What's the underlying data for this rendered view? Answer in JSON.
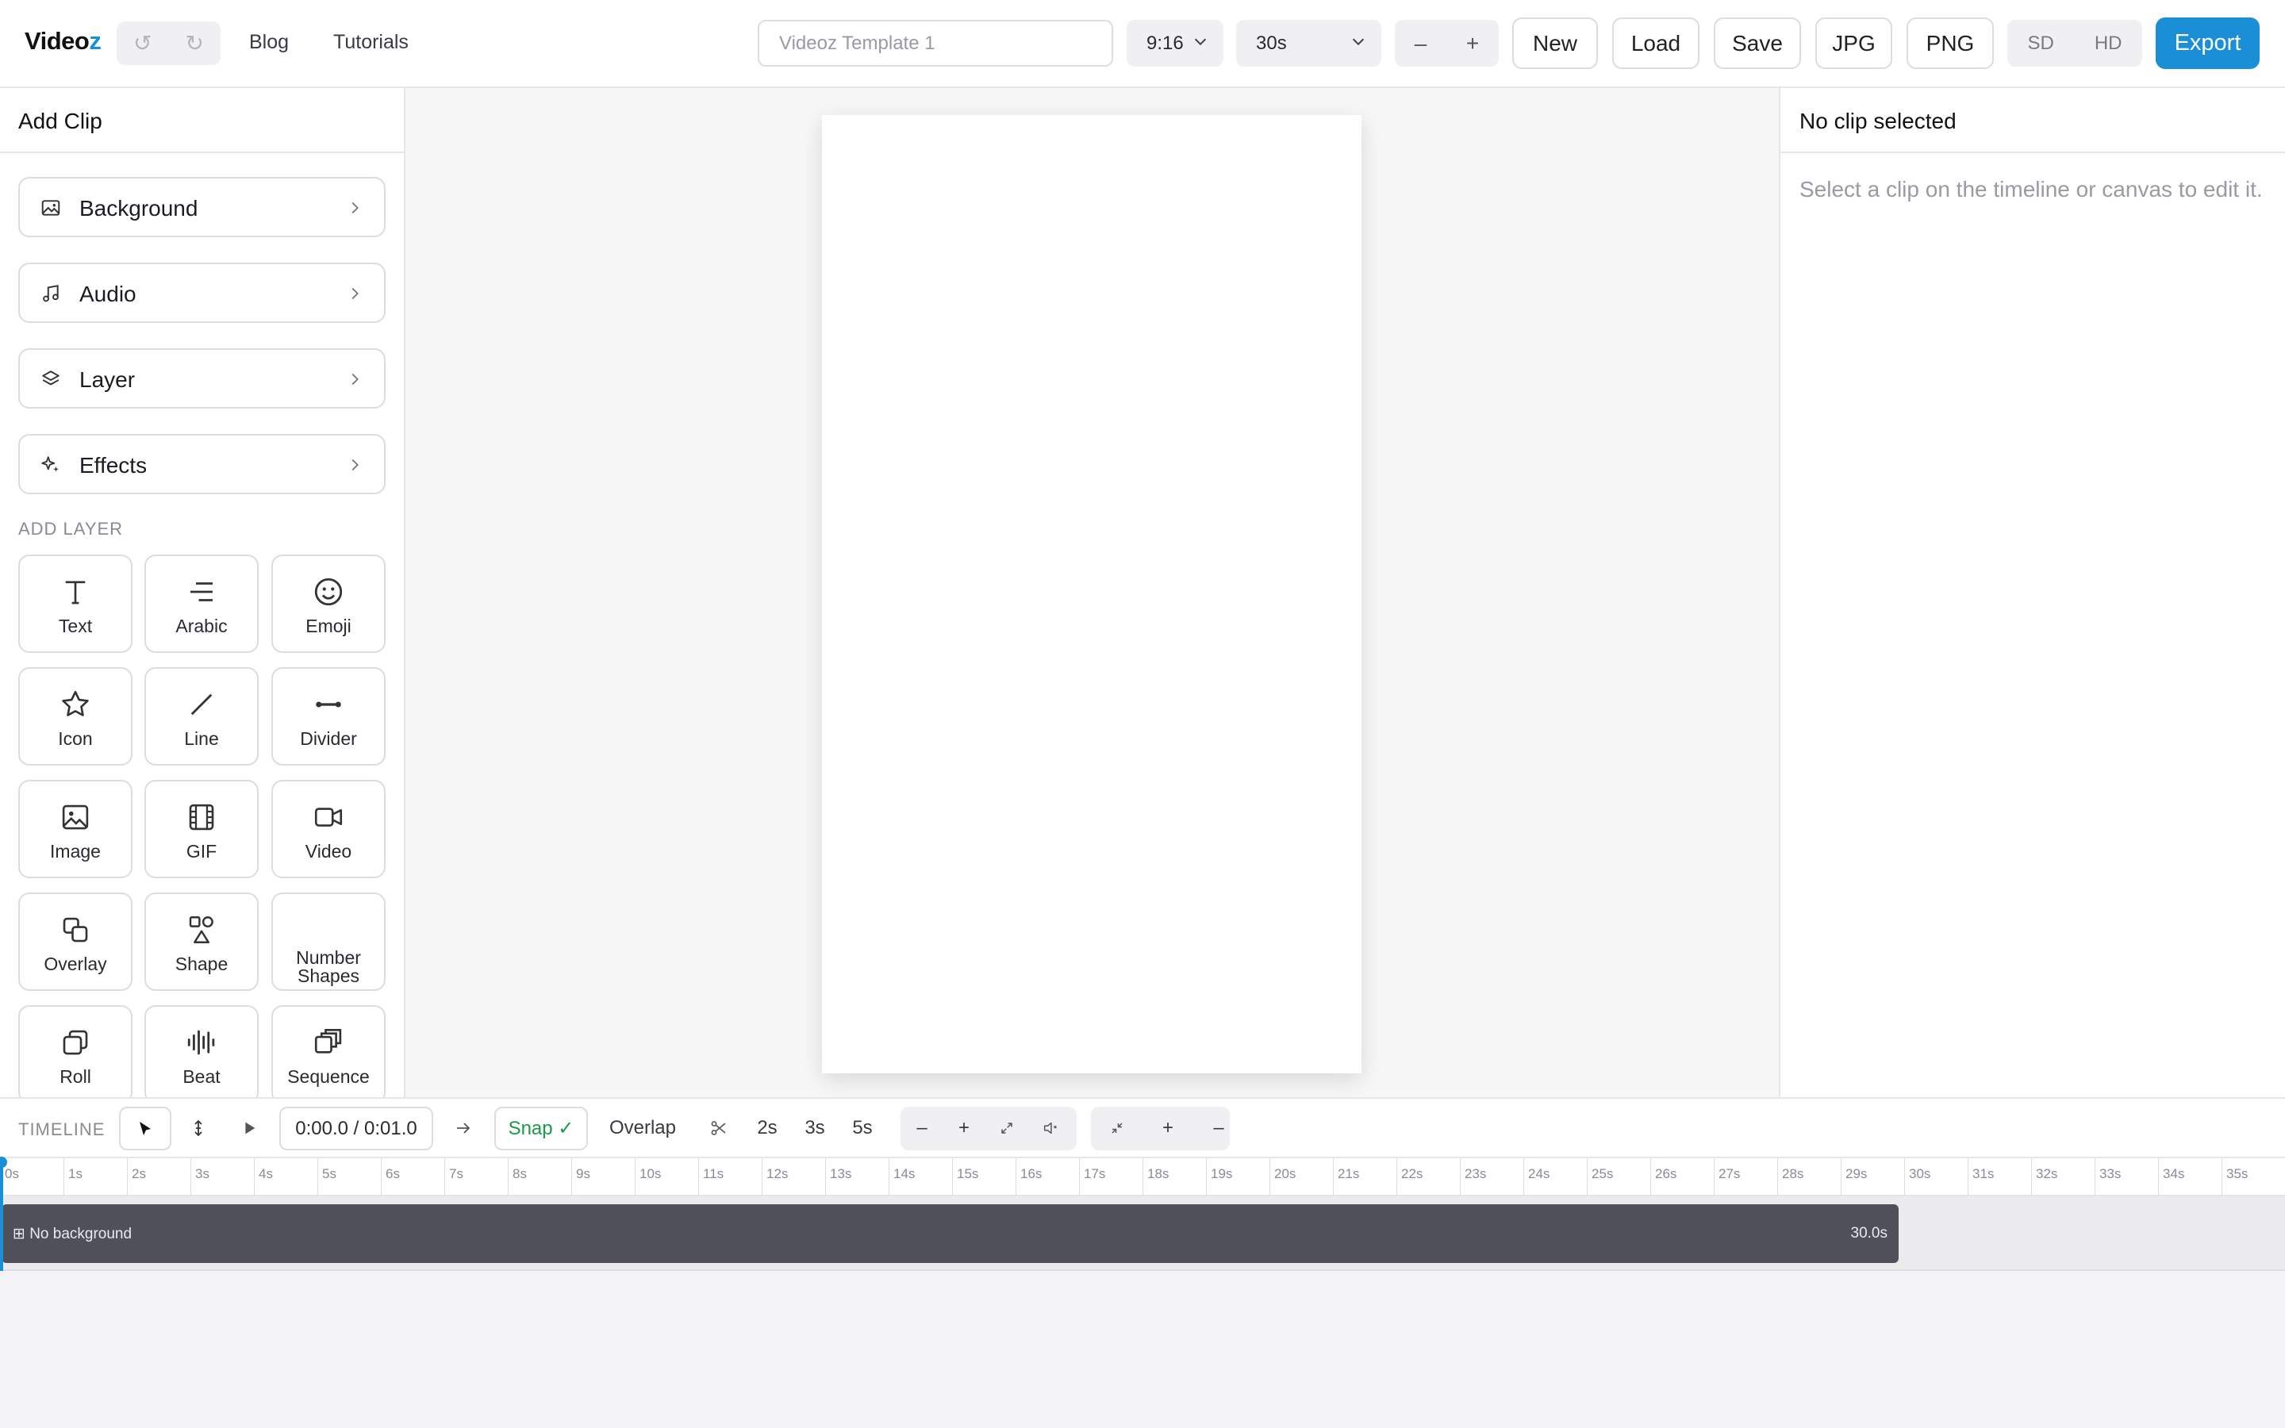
{
  "header": {
    "logo_main": "Video",
    "logo_accent": "z",
    "undo_glyph": "↺",
    "redo_glyph": "↻",
    "nav": [
      {
        "label": "Blog"
      },
      {
        "label": "Tutorials"
      }
    ],
    "template_placeholder": "Videoz Template 1",
    "aspect_ratio": "9:16",
    "duration": "30s",
    "zoom_minus": "–",
    "zoom_plus": "+",
    "buttons": {
      "new": "New",
      "load": "Load",
      "save": "Save",
      "jpg": "JPG",
      "png": "PNG"
    },
    "quality": {
      "sd": "SD",
      "hd": "HD"
    },
    "export": "Export",
    "accent_color": "#1a8fd6"
  },
  "left_panel": {
    "title": "Add Clip",
    "clip_items": [
      {
        "label": "Background",
        "icon": "image-icon"
      },
      {
        "label": "Audio",
        "icon": "music-note-icon"
      },
      {
        "label": "Layer",
        "icon": "layers-icon"
      },
      {
        "label": "Effects",
        "icon": "sparkles-icon"
      }
    ],
    "section_label": "ADD LAYER",
    "tiles": [
      {
        "label": "Text",
        "icon": "text-icon"
      },
      {
        "label": "Arabic",
        "icon": "align-right-icon"
      },
      {
        "label": "Emoji",
        "icon": "smiley-icon"
      },
      {
        "label": "Icon",
        "icon": "star-icon"
      },
      {
        "label": "Line",
        "icon": "line-icon"
      },
      {
        "label": "Divider",
        "icon": "divider-icon"
      },
      {
        "label": "Image",
        "icon": "image-icon"
      },
      {
        "label": "GIF",
        "icon": "film-icon"
      },
      {
        "label": "Video",
        "icon": "video-camera-icon"
      },
      {
        "label": "Overlay",
        "icon": "overlay-icon"
      },
      {
        "label": "Shape",
        "icon": "shapes-icon"
      },
      {
        "label": "Number Shapes",
        "label_line1": "Number",
        "label_line2": "Shapes",
        "icon": "none"
      },
      {
        "label": "Roll",
        "icon": "roll-icon"
      },
      {
        "label": "Beat",
        "icon": "audio-waveform-icon"
      },
      {
        "label": "Sequence",
        "icon": "sequence-icon"
      }
    ]
  },
  "right_panel": {
    "title": "No clip selected",
    "hint": "Select a clip on the timeline or canvas to edit it."
  },
  "timeline": {
    "label": "TIMELINE",
    "time_display": "0:00.0 / 0:01.0",
    "snap": "Snap ✓",
    "overlap": "Overlap",
    "durations": [
      "2s",
      "3s",
      "5s"
    ],
    "group1": [
      "–",
      "+"
    ],
    "group2": [
      "+",
      "–"
    ],
    "ruler_marks": [
      "0s",
      "1s",
      "2s",
      "3s",
      "4s",
      "5s",
      "6s",
      "7s",
      "8s",
      "9s",
      "10s",
      "11s",
      "12s",
      "13s",
      "14s",
      "15s",
      "16s",
      "17s",
      "18s",
      "19s",
      "20s",
      "21s",
      "22s",
      "23s",
      "24s",
      "25s",
      "26s",
      "27s",
      "28s",
      "29s",
      "30s",
      "31s",
      "32s",
      "33s",
      "34s",
      "35s"
    ],
    "clip": {
      "name": "⊞ No background",
      "duration": "30.0s"
    }
  }
}
